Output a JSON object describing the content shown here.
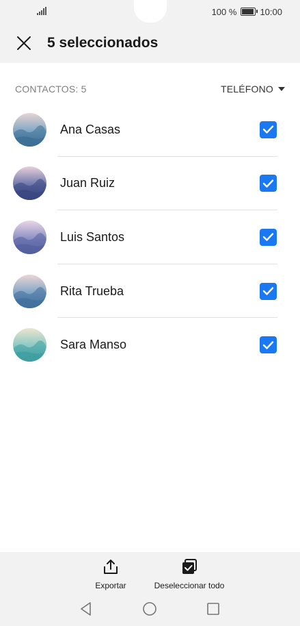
{
  "status_bar": {
    "battery_percent": "100 %",
    "time": "10:00",
    "battery_level": 1.0
  },
  "app_bar": {
    "title": "5 seleccionados"
  },
  "list_header": {
    "count_label": "CONTACTOS: 5",
    "sort_label": "TELÉFONO"
  },
  "contacts": [
    {
      "name": "Ana Casas",
      "checked": true,
      "avatar_colors": [
        "#e9d4d3",
        "#7ea6c4",
        "#3d6f95"
      ]
    },
    {
      "name": "Juan Ruiz",
      "checked": true,
      "avatar_colors": [
        "#e8cfdc",
        "#6a76aa",
        "#39467f"
      ]
    },
    {
      "name": "Luis Santos",
      "checked": true,
      "avatar_colors": [
        "#ead6e6",
        "#8a8ec4",
        "#5560a0"
      ]
    },
    {
      "name": "Rita Trueba",
      "checked": true,
      "avatar_colors": [
        "#ecd6d4",
        "#7fa5c6",
        "#42709c"
      ]
    },
    {
      "name": "Sara Manso",
      "checked": true,
      "avatar_colors": [
        "#eee4cf",
        "#86c8c4",
        "#3f9fa0"
      ]
    }
  ],
  "bottom_actions": {
    "export_label": "Exportar",
    "deselect_label": "Deseleccionar todo"
  },
  "colors": {
    "accent": "#1a78f2",
    "app_bar_bg": "#f2f2f2"
  }
}
